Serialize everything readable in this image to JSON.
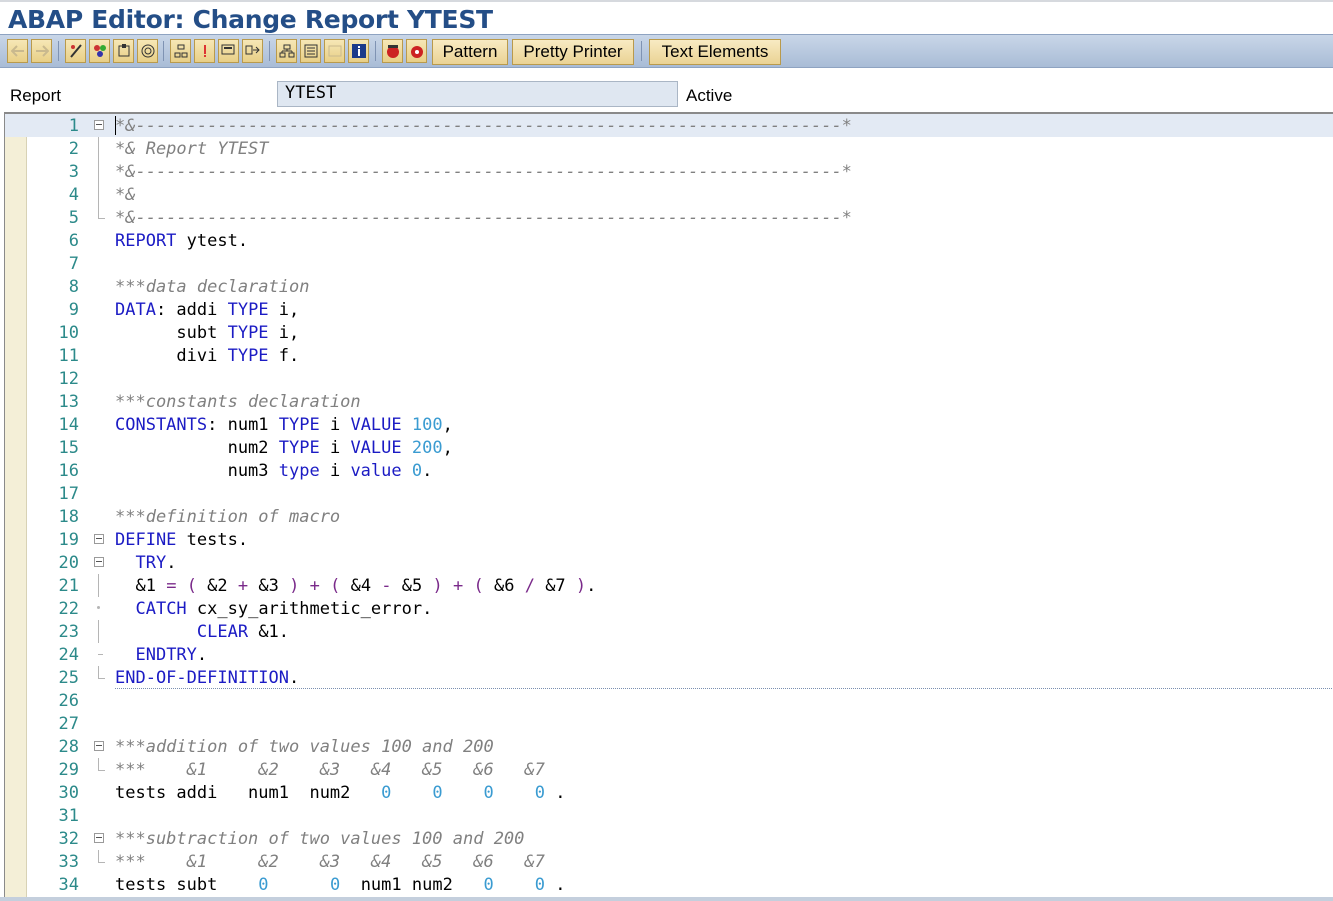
{
  "window": {
    "title": "ABAP Editor: Change Report YTEST"
  },
  "toolbar": {
    "icons": [
      "back-arrow-icon",
      "forward-arrow-icon",
      "other-object-icon",
      "display-change-icon",
      "activate-icon",
      "where-used-icon",
      "object-list-icon",
      "hierarchy-icon",
      "check-icon",
      "display-object-list-icon",
      "next-screen-icon",
      "navigation-window-icon",
      "stack-icon",
      "enhance-icon",
      "help-info-icon",
      "set-breakpoint-icon",
      "session-breakpoint-icon"
    ],
    "pattern_label": "Pattern",
    "pretty_printer_label": "Pretty Printer",
    "text_elements_label": "Text Elements"
  },
  "header": {
    "report_label": "Report",
    "report_name": "YTEST",
    "status": "Active"
  },
  "editor": {
    "lines": [
      {
        "num": "1",
        "segs": [
          {
            "c": "cm",
            "t": "*&---------------------------------------------------------------------*"
          }
        ]
      },
      {
        "num": "2",
        "segs": [
          {
            "c": "cm",
            "t": "*& Report YTEST"
          }
        ]
      },
      {
        "num": "3",
        "segs": [
          {
            "c": "cm",
            "t": "*&---------------------------------------------------------------------*"
          }
        ]
      },
      {
        "num": "4",
        "segs": [
          {
            "c": "cm",
            "t": "*&"
          }
        ]
      },
      {
        "num": "5",
        "segs": [
          {
            "c": "cm",
            "t": "*&---------------------------------------------------------------------*"
          }
        ]
      },
      {
        "num": "6",
        "segs": [
          {
            "c": "kw",
            "t": "REPORT"
          },
          {
            "c": "tx",
            "t": " ytest."
          }
        ]
      },
      {
        "num": "7",
        "segs": []
      },
      {
        "num": "8",
        "segs": [
          {
            "c": "cm",
            "t": "***data declaration"
          }
        ]
      },
      {
        "num": "9",
        "segs": [
          {
            "c": "kw",
            "t": "DATA"
          },
          {
            "c": "tx",
            "t": ": addi "
          },
          {
            "c": "kw",
            "t": "TYPE"
          },
          {
            "c": "tx",
            "t": " i,"
          }
        ]
      },
      {
        "num": "10",
        "segs": [
          {
            "c": "tx",
            "t": "      subt "
          },
          {
            "c": "kw",
            "t": "TYPE"
          },
          {
            "c": "tx",
            "t": " i,"
          }
        ]
      },
      {
        "num": "11",
        "segs": [
          {
            "c": "tx",
            "t": "      divi "
          },
          {
            "c": "kw",
            "t": "TYPE"
          },
          {
            "c": "tx",
            "t": " f."
          }
        ]
      },
      {
        "num": "12",
        "segs": []
      },
      {
        "num": "13",
        "segs": [
          {
            "c": "cm",
            "t": "***constants declaration"
          }
        ]
      },
      {
        "num": "14",
        "segs": [
          {
            "c": "kw",
            "t": "CONSTANTS"
          },
          {
            "c": "tx",
            "t": ": num1 "
          },
          {
            "c": "kw",
            "t": "TYPE"
          },
          {
            "c": "tx",
            "t": " i "
          },
          {
            "c": "kw",
            "t": "VALUE"
          },
          {
            "c": "tx",
            "t": " "
          },
          {
            "c": "num",
            "t": "100"
          },
          {
            "c": "tx",
            "t": ","
          }
        ]
      },
      {
        "num": "15",
        "segs": [
          {
            "c": "tx",
            "t": "           num2 "
          },
          {
            "c": "kw",
            "t": "TYPE"
          },
          {
            "c": "tx",
            "t": " i "
          },
          {
            "c": "kw",
            "t": "VALUE"
          },
          {
            "c": "tx",
            "t": " "
          },
          {
            "c": "num",
            "t": "200"
          },
          {
            "c": "tx",
            "t": ","
          }
        ]
      },
      {
        "num": "16",
        "segs": [
          {
            "c": "tx",
            "t": "           num3 "
          },
          {
            "c": "kw",
            "t": "type"
          },
          {
            "c": "tx",
            "t": " i "
          },
          {
            "c": "kw",
            "t": "value"
          },
          {
            "c": "tx",
            "t": " "
          },
          {
            "c": "num",
            "t": "0"
          },
          {
            "c": "tx",
            "t": "."
          }
        ]
      },
      {
        "num": "17",
        "segs": []
      },
      {
        "num": "18",
        "segs": [
          {
            "c": "cm",
            "t": "***definition of macro"
          }
        ]
      },
      {
        "num": "19",
        "segs": [
          {
            "c": "kw",
            "t": "DEFINE"
          },
          {
            "c": "tx",
            "t": " tests."
          }
        ]
      },
      {
        "num": "20",
        "segs": [
          {
            "c": "tx",
            "t": "  "
          },
          {
            "c": "kw",
            "t": "TRY"
          },
          {
            "c": "tx",
            "t": "."
          }
        ]
      },
      {
        "num": "21",
        "segs": [
          {
            "c": "tx",
            "t": "  &1 "
          },
          {
            "c": "op",
            "t": "="
          },
          {
            "c": "tx",
            "t": " "
          },
          {
            "c": "op",
            "t": "("
          },
          {
            "c": "tx",
            "t": " &2 "
          },
          {
            "c": "op",
            "t": "+"
          },
          {
            "c": "tx",
            "t": " &3 "
          },
          {
            "c": "op",
            "t": ")"
          },
          {
            "c": "tx",
            "t": " "
          },
          {
            "c": "op",
            "t": "+"
          },
          {
            "c": "tx",
            "t": " "
          },
          {
            "c": "op",
            "t": "("
          },
          {
            "c": "tx",
            "t": " &4 "
          },
          {
            "c": "op",
            "t": "-"
          },
          {
            "c": "tx",
            "t": " &5 "
          },
          {
            "c": "op",
            "t": ")"
          },
          {
            "c": "tx",
            "t": " "
          },
          {
            "c": "op",
            "t": "+"
          },
          {
            "c": "tx",
            "t": " "
          },
          {
            "c": "op",
            "t": "("
          },
          {
            "c": "tx",
            "t": " &6 "
          },
          {
            "c": "op",
            "t": "/"
          },
          {
            "c": "tx",
            "t": " &7 "
          },
          {
            "c": "op",
            "t": ")"
          },
          {
            "c": "tx",
            "t": "."
          }
        ]
      },
      {
        "num": "22",
        "segs": [
          {
            "c": "tx",
            "t": "  "
          },
          {
            "c": "kw",
            "t": "CATCH"
          },
          {
            "c": "tx",
            "t": " cx_sy_arithmetic_error."
          }
        ]
      },
      {
        "num": "23",
        "segs": [
          {
            "c": "tx",
            "t": "        "
          },
          {
            "c": "kw",
            "t": "CLEAR"
          },
          {
            "c": "tx",
            "t": " &1."
          }
        ]
      },
      {
        "num": "24",
        "segs": [
          {
            "c": "tx",
            "t": "  "
          },
          {
            "c": "kw",
            "t": "ENDTRY"
          },
          {
            "c": "tx",
            "t": "."
          }
        ]
      },
      {
        "num": "25",
        "segs": [
          {
            "c": "kw",
            "t": "END-OF-DEFINITION"
          },
          {
            "c": "tx",
            "t": "."
          }
        ]
      },
      {
        "num": "26",
        "segs": []
      },
      {
        "num": "27",
        "segs": []
      },
      {
        "num": "28",
        "segs": [
          {
            "c": "cm",
            "t": "***addition of two values 100 and 200"
          }
        ]
      },
      {
        "num": "29",
        "segs": [
          {
            "c": "cm",
            "t": "***    &1     &2    &3   &4   &5   &6   &7"
          }
        ]
      },
      {
        "num": "30",
        "segs": [
          {
            "c": "tx",
            "t": "tests addi   num1  num2   "
          },
          {
            "c": "num",
            "t": "0"
          },
          {
            "c": "tx",
            "t": "    "
          },
          {
            "c": "num",
            "t": "0"
          },
          {
            "c": "tx",
            "t": "    "
          },
          {
            "c": "num",
            "t": "0"
          },
          {
            "c": "tx",
            "t": "    "
          },
          {
            "c": "num",
            "t": "0"
          },
          {
            "c": "tx",
            "t": " ."
          }
        ]
      },
      {
        "num": "31",
        "segs": []
      },
      {
        "num": "32",
        "segs": [
          {
            "c": "cm",
            "t": "***subtraction of two values 100 and 200"
          }
        ]
      },
      {
        "num": "33",
        "segs": [
          {
            "c": "cm",
            "t": "***    &1     &2    &3   &4   &5   &6   &7"
          }
        ]
      },
      {
        "num": "34",
        "segs": [
          {
            "c": "tx",
            "t": "tests subt    "
          },
          {
            "c": "num",
            "t": "0"
          },
          {
            "c": "tx",
            "t": "      "
          },
          {
            "c": "num",
            "t": "0"
          },
          {
            "c": "tx",
            "t": "  num1 num2   "
          },
          {
            "c": "num",
            "t": "0"
          },
          {
            "c": "tx",
            "t": "    "
          },
          {
            "c": "num",
            "t": "0"
          },
          {
            "c": "tx",
            "t": " ."
          }
        ]
      }
    ]
  },
  "colors": {
    "title": "#244e87",
    "keyword": "#1b1bc4",
    "comment": "#808080",
    "number": "#3a9bd1",
    "operator": "#7a2a8a",
    "line_number": "#2c8a8a"
  }
}
